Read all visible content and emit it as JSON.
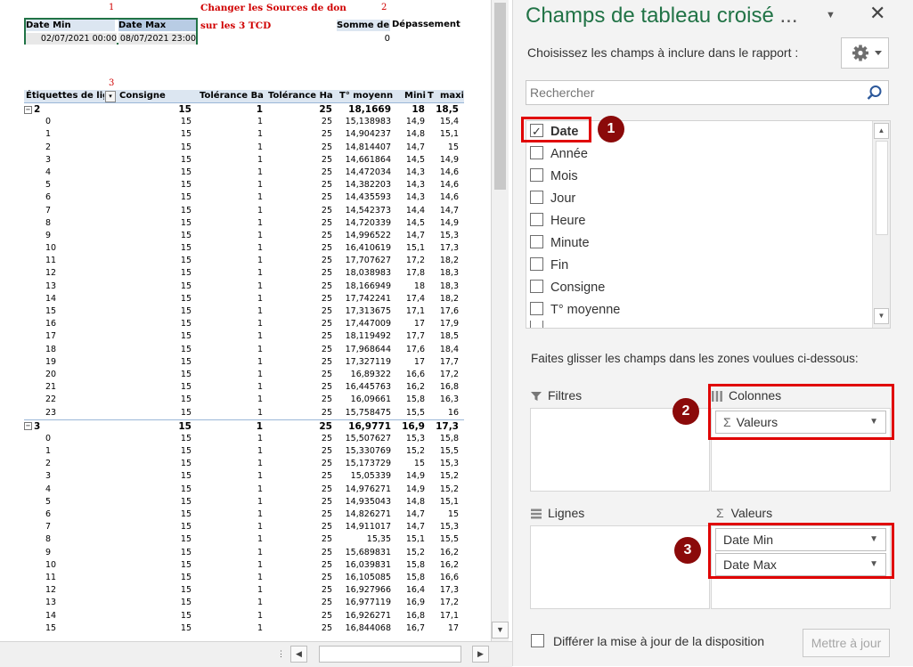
{
  "sheet": {
    "top_red_numbers": [
      "1",
      "2",
      "3"
    ],
    "note_line1": "Changer les Sources de don",
    "note_line2": "sur les 3 TCD",
    "filter_table": {
      "headers": [
        "Date Min",
        "Date Max"
      ],
      "values": [
        "02/07/2021 00:00",
        "08/07/2021 23:00"
      ]
    },
    "sum_table": {
      "header": "Somme de Dépassement",
      "value": "0"
    },
    "pivot": {
      "headers": [
        "Étiquettes de lig",
        "Consigne",
        "Tolérance Ba",
        "Tolérance Ha",
        "T° moyenn",
        "Mini",
        "T",
        "maxi"
      ],
      "rows": [
        {
          "label": "2",
          "consigne": "15",
          "tb": "1",
          "th": "25",
          "moy": "18,1669",
          "mini": "18",
          "maxi": "18,5",
          "group": true
        },
        {
          "label": "0",
          "consigne": "15",
          "tb": "1",
          "th": "25",
          "moy": "15,138983",
          "mini": "14,9",
          "maxi": "15,4"
        },
        {
          "label": "1",
          "consigne": "15",
          "tb": "1",
          "th": "25",
          "moy": "14,904237",
          "mini": "14,8",
          "maxi": "15,1"
        },
        {
          "label": "2",
          "consigne": "15",
          "tb": "1",
          "th": "25",
          "moy": "14,814407",
          "mini": "14,7",
          "maxi": "15"
        },
        {
          "label": "3",
          "consigne": "15",
          "tb": "1",
          "th": "25",
          "moy": "14,661864",
          "mini": "14,5",
          "maxi": "14,9"
        },
        {
          "label": "4",
          "consigne": "15",
          "tb": "1",
          "th": "25",
          "moy": "14,472034",
          "mini": "14,3",
          "maxi": "14,6"
        },
        {
          "label": "5",
          "consigne": "15",
          "tb": "1",
          "th": "25",
          "moy": "14,382203",
          "mini": "14,3",
          "maxi": "14,6"
        },
        {
          "label": "6",
          "consigne": "15",
          "tb": "1",
          "th": "25",
          "moy": "14,435593",
          "mini": "14,3",
          "maxi": "14,6"
        },
        {
          "label": "7",
          "consigne": "15",
          "tb": "1",
          "th": "25",
          "moy": "14,542373",
          "mini": "14,4",
          "maxi": "14,7"
        },
        {
          "label": "8",
          "consigne": "15",
          "tb": "1",
          "th": "25",
          "moy": "14,720339",
          "mini": "14,5",
          "maxi": "14,9"
        },
        {
          "label": "9",
          "consigne": "15",
          "tb": "1",
          "th": "25",
          "moy": "14,996522",
          "mini": "14,7",
          "maxi": "15,3"
        },
        {
          "label": "10",
          "consigne": "15",
          "tb": "1",
          "th": "25",
          "moy": "16,410619",
          "mini": "15,1",
          "maxi": "17,3"
        },
        {
          "label": "11",
          "consigne": "15",
          "tb": "1",
          "th": "25",
          "moy": "17,707627",
          "mini": "17,2",
          "maxi": "18,2"
        },
        {
          "label": "12",
          "consigne": "15",
          "tb": "1",
          "th": "25",
          "moy": "18,038983",
          "mini": "17,8",
          "maxi": "18,3"
        },
        {
          "label": "13",
          "consigne": "15",
          "tb": "1",
          "th": "25",
          "moy": "18,166949",
          "mini": "18",
          "maxi": "18,3"
        },
        {
          "label": "14",
          "consigne": "15",
          "tb": "1",
          "th": "25",
          "moy": "17,742241",
          "mini": "17,4",
          "maxi": "18,2"
        },
        {
          "label": "15",
          "consigne": "15",
          "tb": "1",
          "th": "25",
          "moy": "17,313675",
          "mini": "17,1",
          "maxi": "17,6"
        },
        {
          "label": "16",
          "consigne": "15",
          "tb": "1",
          "th": "25",
          "moy": "17,447009",
          "mini": "17",
          "maxi": "17,9"
        },
        {
          "label": "17",
          "consigne": "15",
          "tb": "1",
          "th": "25",
          "moy": "18,119492",
          "mini": "17,7",
          "maxi": "18,5"
        },
        {
          "label": "18",
          "consigne": "15",
          "tb": "1",
          "th": "25",
          "moy": "17,968644",
          "mini": "17,6",
          "maxi": "18,4"
        },
        {
          "label": "19",
          "consigne": "15",
          "tb": "1",
          "th": "25",
          "moy": "17,327119",
          "mini": "17",
          "maxi": "17,7"
        },
        {
          "label": "20",
          "consigne": "15",
          "tb": "1",
          "th": "25",
          "moy": "16,89322",
          "mini": "16,6",
          "maxi": "17,2"
        },
        {
          "label": "21",
          "consigne": "15",
          "tb": "1",
          "th": "25",
          "moy": "16,445763",
          "mini": "16,2",
          "maxi": "16,8"
        },
        {
          "label": "22",
          "consigne": "15",
          "tb": "1",
          "th": "25",
          "moy": "16,09661",
          "mini": "15,8",
          "maxi": "16,3"
        },
        {
          "label": "23",
          "consigne": "15",
          "tb": "1",
          "th": "25",
          "moy": "15,758475",
          "mini": "15,5",
          "maxi": "16"
        },
        {
          "label": "3",
          "consigne": "15",
          "tb": "1",
          "th": "25",
          "moy": "16,9771",
          "mini": "16,9",
          "maxi": "17,3",
          "group": true
        },
        {
          "label": "0",
          "consigne": "15",
          "tb": "1",
          "th": "25",
          "moy": "15,507627",
          "mini": "15,3",
          "maxi": "15,8"
        },
        {
          "label": "1",
          "consigne": "15",
          "tb": "1",
          "th": "25",
          "moy": "15,330769",
          "mini": "15,2",
          "maxi": "15,5"
        },
        {
          "label": "2",
          "consigne": "15",
          "tb": "1",
          "th": "25",
          "moy": "15,173729",
          "mini": "15",
          "maxi": "15,3"
        },
        {
          "label": "3",
          "consigne": "15",
          "tb": "1",
          "th": "25",
          "moy": "15,05339",
          "mini": "14,9",
          "maxi": "15,2"
        },
        {
          "label": "4",
          "consigne": "15",
          "tb": "1",
          "th": "25",
          "moy": "14,976271",
          "mini": "14,9",
          "maxi": "15,2"
        },
        {
          "label": "5",
          "consigne": "15",
          "tb": "1",
          "th": "25",
          "moy": "14,935043",
          "mini": "14,8",
          "maxi": "15,1"
        },
        {
          "label": "6",
          "consigne": "15",
          "tb": "1",
          "th": "25",
          "moy": "14,826271",
          "mini": "14,7",
          "maxi": "15"
        },
        {
          "label": "7",
          "consigne": "15",
          "tb": "1",
          "th": "25",
          "moy": "14,911017",
          "mini": "14,7",
          "maxi": "15,3"
        },
        {
          "label": "8",
          "consigne": "15",
          "tb": "1",
          "th": "25",
          "moy": "15,35",
          "mini": "15,1",
          "maxi": "15,5"
        },
        {
          "label": "9",
          "consigne": "15",
          "tb": "1",
          "th": "25",
          "moy": "15,689831",
          "mini": "15,2",
          "maxi": "16,2"
        },
        {
          "label": "10",
          "consigne": "15",
          "tb": "1",
          "th": "25",
          "moy": "16,039831",
          "mini": "15,8",
          "maxi": "16,2"
        },
        {
          "label": "11",
          "consigne": "15",
          "tb": "1",
          "th": "25",
          "moy": "16,105085",
          "mini": "15,8",
          "maxi": "16,6"
        },
        {
          "label": "12",
          "consigne": "15",
          "tb": "1",
          "th": "25",
          "moy": "16,927966",
          "mini": "16,4",
          "maxi": "17,3"
        },
        {
          "label": "13",
          "consigne": "15",
          "tb": "1",
          "th": "25",
          "moy": "16,977119",
          "mini": "16,9",
          "maxi": "17,2"
        },
        {
          "label": "14",
          "consigne": "15",
          "tb": "1",
          "th": "25",
          "moy": "16,926271",
          "mini": "16,8",
          "maxi": "17,1"
        },
        {
          "label": "15",
          "consigne": "15",
          "tb": "1",
          "th": "25",
          "moy": "16,844068",
          "mini": "16,7",
          "maxi": "17"
        }
      ]
    }
  },
  "pane": {
    "title_main": "Champs de tableau croisé",
    "title_ellipsis": " ...",
    "choose_label": "Choisissez les champs à inclure dans le rapport :",
    "search_placeholder": "Rechercher",
    "fields": [
      {
        "label": "Date",
        "checked": true
      },
      {
        "label": "Année",
        "checked": false
      },
      {
        "label": "Mois",
        "checked": false
      },
      {
        "label": "Jour",
        "checked": false
      },
      {
        "label": "Heure",
        "checked": false
      },
      {
        "label": "Minute",
        "checked": false
      },
      {
        "label": "Fin",
        "checked": false
      },
      {
        "label": "Consigne",
        "checked": false
      },
      {
        "label": "T° moyenne",
        "checked": false
      }
    ],
    "drag_hint": "Faites glisser les champs dans les zones voulues ci-dessous:",
    "zones": {
      "filtres": "Filtres",
      "colonnes": "Colonnes",
      "lignes": "Lignes",
      "valeurs": "Valeurs",
      "colonnes_item": "Valeurs",
      "valeurs_items": [
        "Date Min",
        "Date Max"
      ]
    },
    "badges": [
      "1",
      "2",
      "3"
    ],
    "defer_label": "Différer la mise à jour de la disposition",
    "update_button": "Mettre à jour",
    "accent_color": "#217346",
    "highlight_color": "#e00000",
    "badge_color": "#8b0a0a"
  }
}
